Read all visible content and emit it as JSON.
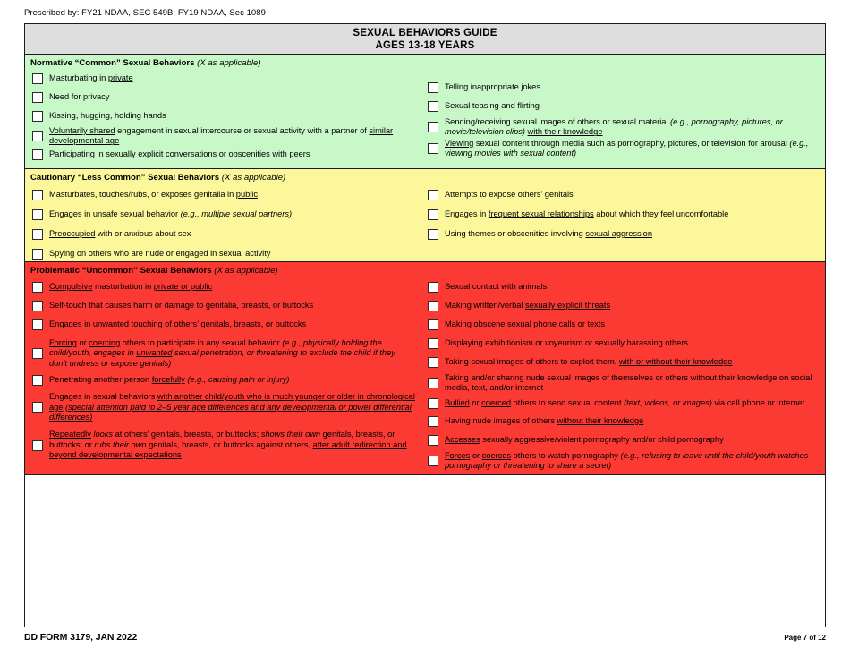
{
  "document": {
    "prescribed_by": "Prescribed by: FY21 NDAA, SEC 549B; FY19 NDAA, Sec 1089",
    "title_line1": "SEXUAL BEHAVIORS GUIDE",
    "title_line2": "AGES 13-18 YEARS",
    "footer_form": "DD FORM 3179, JAN 2022",
    "footer_page": "Page 7 of 12"
  },
  "colors": {
    "normative_bg": "#c8f7c8",
    "cautionary_bg": "#fbf79a",
    "problematic_bg": "#fc3a34",
    "title_bg": "#dedede",
    "border": "#1a1a1a"
  },
  "sections": [
    {
      "id": "normative",
      "heading": "Normative “Common” Sexual Behaviors",
      "heading_note": "(X as applicable)",
      "left_items": [
        "Masturbating in <u>private</u>",
        "Need for privacy",
        "Kissing, hugging, holding hands",
        "<u>Voluntarily shared</u> engagement in sexual intercourse or sexual activity with a partner of <u>similar developmental age</u>",
        "Participating in sexually explicit conversations or obscenities <u>with peers</u>"
      ],
      "right_items": [
        "Telling inappropriate jokes",
        "Sexual teasing and flirting",
        "Sending/receiving sexual images of others or sexual material <i>(e.g., pornography, pictures, or movie/television clips)</i> <u>with their knowledge</u>",
        "<u>Viewing</u> sexual content through media such as pornography, pictures, or television for arousal <i>(e.g., viewing movies with sexual content)</i>"
      ]
    },
    {
      "id": "cautionary",
      "heading": "Cautionary “Less Common” Sexual Behaviors",
      "heading_note": "(X as applicable)",
      "left_items": [
        "Masturbates, touches/rubs, or exposes genitalia in <u>public</u>",
        "Engages in unsafe sexual behavior <i>(e.g., multiple sexual partners)</i>",
        "<u>Preoccupied</u> with or anxious about sex",
        "Spying on others who are nude or engaged in sexual activity"
      ],
      "right_items": [
        "Attempts to expose others’ genitals",
        "Engages in <u>frequent sexual relationships</u> about which they feel uncomfortable",
        "Using themes or obscenities involving <u>sexual aggression</u>"
      ]
    },
    {
      "id": "problematic",
      "heading": "Problematic “Uncommon” Sexual Behaviors",
      "heading_note": "(X as applicable)",
      "left_items": [
        "<u>Compulsive</u> masturbation in <u>private or public</u>",
        "Self-touch that causes harm or damage to genitalia, breasts, or buttocks",
        "Engages in <u>unwanted</u> touching of others’ genitals, breasts, or buttocks",
        "<u>Forcing</u> or <u>coercing</u> others to participate in any sexual behavior <i>(e.g., physically holding the child/youth, engages in <u>unwanted</u> sexual penetration, or threatening to exclude the child if they don’t undress or expose genitals)</i>",
        "Penetrating another person <u>forcefully</u> <i>(e.g., causing pain or injury)</i>",
        "Engages in sexual behaviors <u>with another child/youth who is much younger or older in chronological age</u> <i><u>(special attention paid to 2–5 year age differences and any developmental or power differential differences)</u></i>",
        "<u>Repeatedly</u> <i>looks</i> at others’ genitals, breasts, or buttocks; <i>shows their own</i> genitals, breasts, or buttocks; or <i>rubs their own</i> genitals, breasts, or buttocks against others, <u>after adult redirection and beyond developmental expectations</u>"
      ],
      "right_items": [
        "Sexual contact with animals",
        "Making written/verbal <u>sexually explicit threats</u>",
        "Making obscene sexual phone calls or texts",
        "Displaying exhibitionism or voyeurism or sexually harassing others",
        "Taking sexual images of others to exploit them, <u>with or without their knowledge</u>",
        "Taking and/or sharing nude sexual images of themselves or others without their knowledge on social media, text, and/or internet",
        "<u>Bullied</u> or <u>coerced</u> others to send sexual content <i>(text, videos, or images)</i> via cell phone or internet",
        "Having nude images of others <u>without their knowledge</u>",
        "<u>Accesses</u> sexually aggressive/violent pornography and/or child pornography",
        "<u>Forces</u> or <u>coerces</u> others to watch pornography <i>(e.g., refusing to leave until the child/youth watches pornography or threatening to share a secret)</i>"
      ]
    }
  ]
}
